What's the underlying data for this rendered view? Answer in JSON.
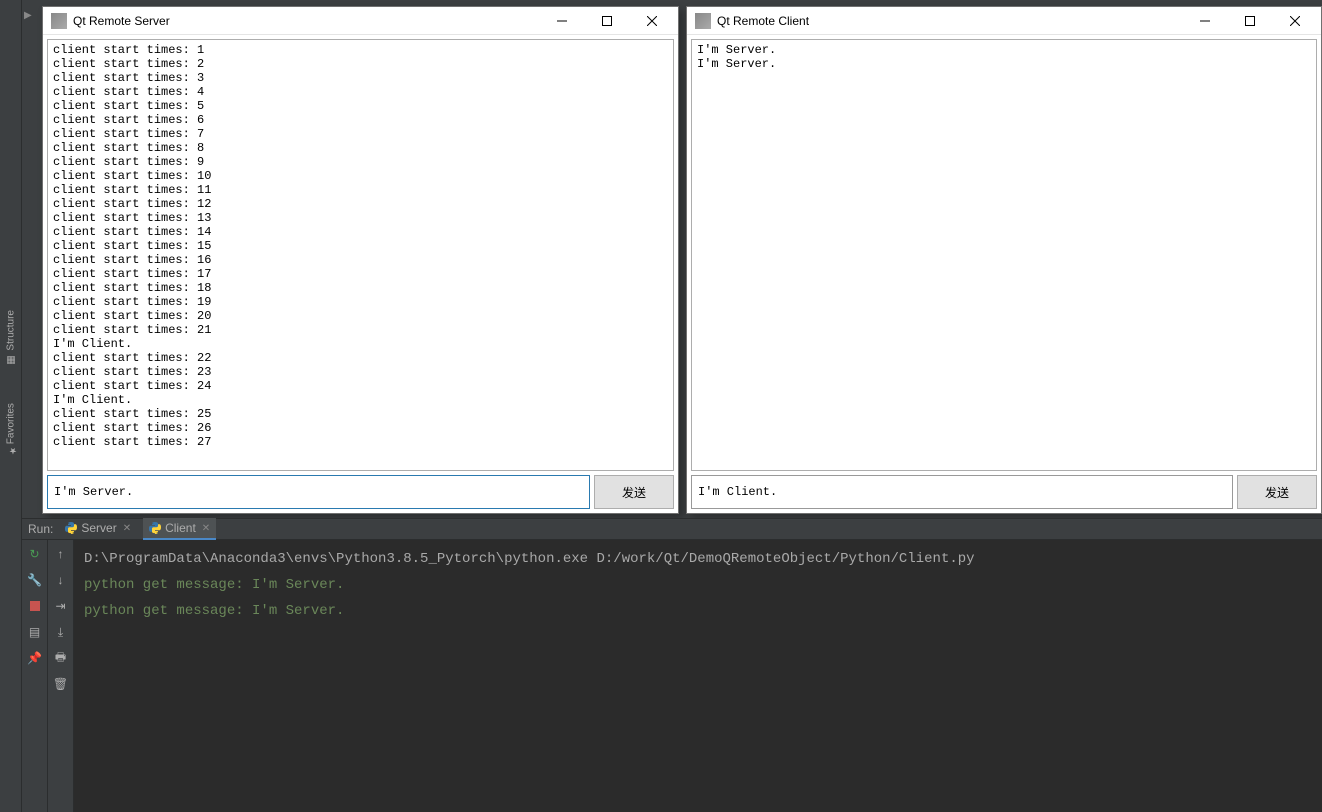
{
  "ide": {
    "left_rail": {
      "structure": "Structure",
      "favorites": "Favorites"
    },
    "run_label": "Run:",
    "tabs": [
      {
        "label": "Server",
        "active": false
      },
      {
        "label": "Client",
        "active": true
      }
    ],
    "console": {
      "cmd": "D:\\ProgramData\\Anaconda3\\envs\\Python3.8.5_Pytorch\\python.exe D:/work/Qt/DemoQRemoteObject/Python/Client.py",
      "out1": "python get message: I'm Server.",
      "out2": "python get message: I'm Server."
    }
  },
  "server_window": {
    "title": "Qt Remote Server",
    "log": [
      "client start times: 1",
      "client start times: 2",
      "client start times: 3",
      "client start times: 4",
      "client start times: 5",
      "client start times: 6",
      "client start times: 7",
      "client start times: 8",
      "client start times: 9",
      "client start times: 10",
      "client start times: 11",
      "client start times: 12",
      "client start times: 13",
      "client start times: 14",
      "client start times: 15",
      "client start times: 16",
      "client start times: 17",
      "client start times: 18",
      "client start times: 19",
      "client start times: 20",
      "client start times: 21",
      "I'm Client.",
      "client start times: 22",
      "client start times: 23",
      "client start times: 24",
      "I'm Client.",
      "client start times: 25",
      "client start times: 26",
      "client start times: 27"
    ],
    "input_value": "I'm Server.",
    "send_label": "发送"
  },
  "client_window": {
    "title": "Qt Remote Client",
    "log": [
      "I'm Server.",
      "I'm Server."
    ],
    "input_value": "I'm Client.",
    "send_label": "发送"
  }
}
